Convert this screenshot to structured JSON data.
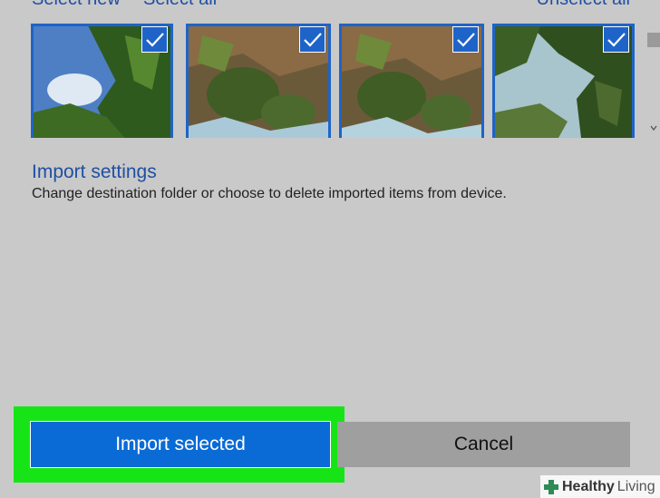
{
  "top_links": {
    "select_new": "Select new",
    "select_all": "Select all",
    "unselect_all": "Unselect all"
  },
  "photos": [
    {
      "checked": true
    },
    {
      "checked": true
    },
    {
      "checked": true
    },
    {
      "checked": true
    }
  ],
  "import_settings": {
    "title": "Import settings",
    "description": "Change destination folder or choose to delete imported items from device."
  },
  "buttons": {
    "import_selected": "Import selected",
    "cancel": "Cancel"
  },
  "watermark": {
    "word1": "Healthy",
    "word2": "Living"
  },
  "colors": {
    "accent": "#0a6bd6",
    "highlight": "#17e417",
    "link": "#1f4fa3",
    "background": "#c9c9c9"
  }
}
